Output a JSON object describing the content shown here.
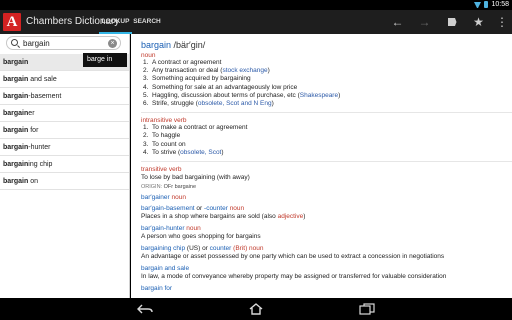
{
  "status": {
    "time": "10:58"
  },
  "app": {
    "title": "Chambers Dictionary",
    "logo_letter": "A"
  },
  "tabs": [
    {
      "label": "LOOKUP"
    },
    {
      "label": "SEARCH"
    }
  ],
  "toolbar": {
    "icons": [
      "back-arrow-icon",
      "forward-arrow-icon",
      "bookmark-icon",
      "star-icon",
      "overflow-menu-icon"
    ]
  },
  "search": {
    "value": "bargain",
    "placeholder": ""
  },
  "tooltip": {
    "text": "barge in"
  },
  "wordlist": [
    {
      "bold": "bargain",
      "rest": ""
    },
    {
      "bold": "bargain",
      "rest": " and sale"
    },
    {
      "bold": "bargain",
      "rest": "-basement"
    },
    {
      "bold": "bargain",
      "rest": "er"
    },
    {
      "bold": "bargain",
      "rest": " for"
    },
    {
      "bold": "bargain",
      "rest": "-hunter"
    },
    {
      "bold": "bargain",
      "rest": "ing chip"
    },
    {
      "bold": "bargain",
      "rest": " on"
    }
  ],
  "entry": {
    "headword": "bargain",
    "pronunciation": " /bär′gin/",
    "noun_label": "noun",
    "noun_senses": [
      {
        "n": "1.",
        "text": "A contract or agreement",
        "link": "",
        "after": ""
      },
      {
        "n": "2.",
        "text": "Any transaction or deal (",
        "link": "stock exchange",
        "after": ")"
      },
      {
        "n": "3.",
        "text": "Something acquired by bargaining",
        "link": "",
        "after": ""
      },
      {
        "n": "4.",
        "text": "Something for sale at an advantageously low price",
        "link": "",
        "after": ""
      },
      {
        "n": "5.",
        "text": "Haggling, discussion about terms of purchase, etc (",
        "link": "Shakespeare",
        "after": ")"
      },
      {
        "n": "6.",
        "text": "Strife, struggle (",
        "link": "obsolete, Scot and N Eng",
        "after": ")"
      }
    ],
    "intransitive_label": "intransitive verb",
    "intransitive_senses": [
      {
        "n": "1.",
        "text": "To make a contract or agreement",
        "link": "",
        "after": ""
      },
      {
        "n": "2.",
        "text": "To haggle",
        "link": "",
        "after": ""
      },
      {
        "n": "3.",
        "text": "To count on",
        "link": "",
        "after": ""
      },
      {
        "n": "4.",
        "text": "To strive (",
        "link": "obsolete, Scot",
        "after": ")"
      }
    ],
    "transitive_label": "transitive verb",
    "transitive_text": "To lose by bad bargaining (with away)",
    "origin_label": "ORIGIN:",
    "origin_text": " OFr bargaine",
    "subentries": [
      {
        "hw": "bar′gainer",
        "pos": " noun",
        "mid": "",
        "hw2": "",
        "pos2": "",
        "def": ""
      },
      {
        "hw": "bar′gain-basement",
        "pos": "",
        "mid": " or ",
        "hw2": "-counter",
        "pos2": " noun",
        "def": "Places in a shop where bargains are sold (also ",
        "def_tag": "adjective",
        "def_after": ")"
      },
      {
        "hw": "bar′gain-hunter",
        "pos": " noun",
        "mid": "",
        "hw2": "",
        "pos2": "",
        "def": "A person who goes shopping for bargains",
        "def_tag": "",
        "def_after": ""
      },
      {
        "hw": "bargaining chip",
        "pos": "",
        "mid": " (US) or ",
        "hw2": "counter",
        "pos2": " (Brit) noun",
        "def": "An advantage or asset possessed by one party which can be used to extract a concession in negotiations",
        "def_tag": "",
        "def_after": ""
      },
      {
        "hw": "bargain and sale",
        "pos": "",
        "mid": "",
        "hw2": "",
        "pos2": "",
        "def": "In law, a mode of conveyance whereby property may be assigned or transferred for valuable consideration",
        "def_tag": "",
        "def_after": ""
      },
      {
        "hw": "bargain for",
        "pos": "",
        "mid": "",
        "hw2": "",
        "pos2": "",
        "def": "",
        "def_tag": "",
        "def_after": ""
      }
    ]
  },
  "colors": {
    "accent": "#33b5e5",
    "headword": "#1a5fb4",
    "pos": "#c0392b",
    "logo": "#d42222"
  }
}
